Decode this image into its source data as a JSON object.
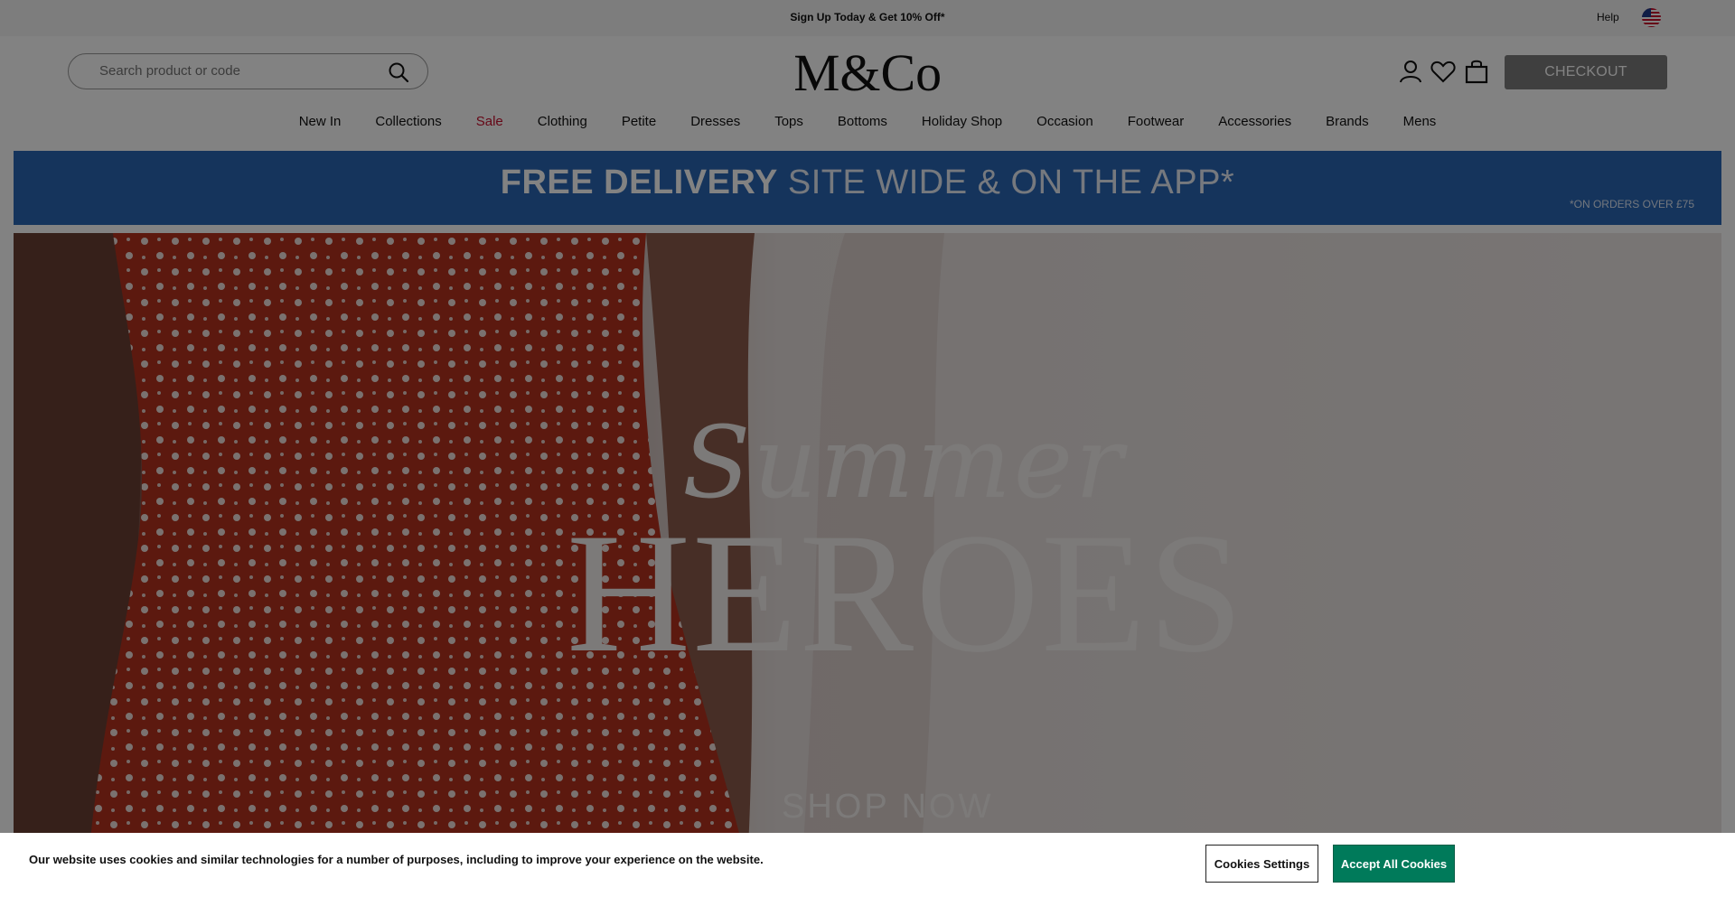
{
  "promo": {
    "text": "Sign Up Today & Get 10% Off*",
    "help": "Help",
    "flag_icon": "us-flag-icon"
  },
  "search": {
    "placeholder": "Search product or code"
  },
  "brand": {
    "logo": "M&Co"
  },
  "header": {
    "checkout_label": "CHECKOUT",
    "icons": [
      "account-icon",
      "wishlist-heart-icon",
      "shopping-bag-icon"
    ]
  },
  "nav": {
    "items": [
      {
        "label": "New In"
      },
      {
        "label": "Collections"
      },
      {
        "label": "Sale",
        "color": "#c8102e"
      },
      {
        "label": "Clothing"
      },
      {
        "label": "Petite"
      },
      {
        "label": "Dresses"
      },
      {
        "label": "Tops"
      },
      {
        "label": "Bottoms"
      },
      {
        "label": "Holiday Shop"
      },
      {
        "label": "Occasion"
      },
      {
        "label": "Footwear"
      },
      {
        "label": "Accessories"
      },
      {
        "label": "Brands"
      },
      {
        "label": "Mens"
      }
    ]
  },
  "delivery_banner": {
    "bold": "FREE DELIVERY",
    "rest": "SITE WIDE & ON THE APP*",
    "note": "*ON ORDERS OVER £75",
    "color": "#2a66b5"
  },
  "hero": {
    "line1": "Summer",
    "line2": "HEROES",
    "cta": "SHOP NOW"
  },
  "cookie": {
    "text": "Our website uses cookies and similar technologies for a number of purposes, including to improve your experience on the website.",
    "settings_label": "Cookies Settings",
    "accept_label": "Accept All Cookies",
    "accept_color": "#007a5a"
  }
}
